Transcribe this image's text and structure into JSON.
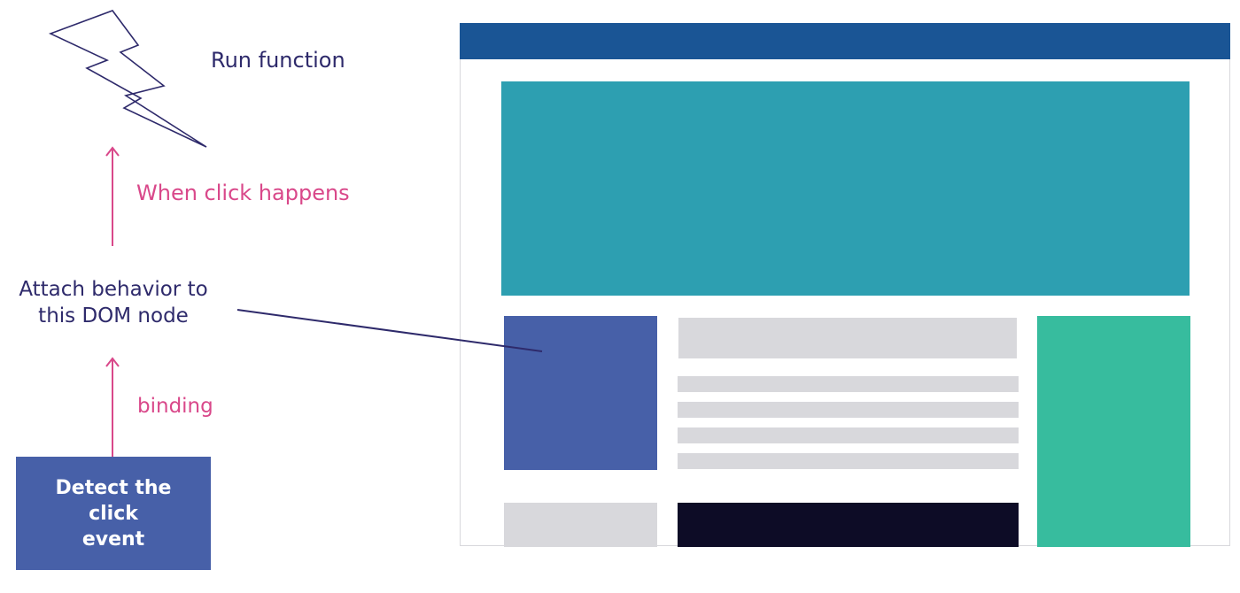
{
  "diagram": {
    "steps": {
      "run": "Run function",
      "when": "When click happens",
      "attach_line1": "Attach behavior to",
      "attach_line2": "this DOM node",
      "binding": "binding",
      "detect_line1": "Detect the click",
      "detect_line2": "event"
    },
    "colors": {
      "navy_text": "#2e2a6b",
      "pink_text": "#d9488a",
      "box_blue": "#4760a8",
      "header_blue": "#1a5595",
      "hero_teal": "#2d9fb1",
      "green": "#37bc9e",
      "gray": "#d8d8dc",
      "dark": "#0d0c26"
    },
    "icons": [
      "lightning-bolt-icon",
      "arrow-up-icon"
    ]
  }
}
